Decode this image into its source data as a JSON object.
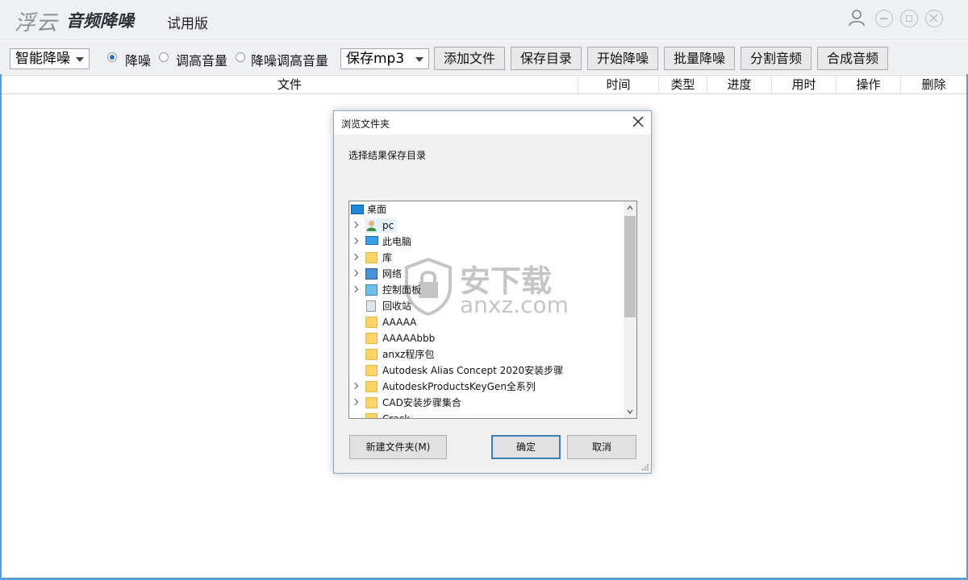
{
  "titlebar": {
    "brand": "浮云",
    "product": "音频降噪",
    "edition": "试用版"
  },
  "toolbar": {
    "mode_select": "智能降噪",
    "radio1": "降噪",
    "radio2": "调高音量",
    "radio3": "降噪调高音量",
    "format_select": "保存mp3",
    "btn_add": "添加文件",
    "btn_savedir": "保存目录",
    "btn_start": "开始降噪",
    "btn_batch": "批量降噪",
    "btn_split": "分割音频",
    "btn_merge": "合成音频"
  },
  "table": {
    "columns": [
      "文件",
      "时间",
      "类型",
      "进度",
      "用时",
      "操作",
      "删除"
    ]
  },
  "dialog": {
    "title": "浏览文件夹",
    "prompt": "选择结果保存目录",
    "tree": [
      {
        "label": "桌面",
        "icon": "desktop-icon"
      },
      {
        "label": "pc",
        "icon": "user-icon"
      },
      {
        "label": "此电脑",
        "icon": "computer-icon"
      },
      {
        "label": "库",
        "icon": "library-icon"
      },
      {
        "label": "网络",
        "icon": "network-icon"
      },
      {
        "label": "控制面板",
        "icon": "control-panel-icon"
      },
      {
        "label": "回收站",
        "icon": "recycle-bin-icon"
      },
      {
        "label": "AAAAA",
        "icon": "folder-icon"
      },
      {
        "label": "AAAAAbbb",
        "icon": "folder-icon"
      },
      {
        "label": "anxz程序包",
        "icon": "folder-icon"
      },
      {
        "label": "Autodesk Alias Concept 2020安装步骤",
        "icon": "folder-icon"
      },
      {
        "label": "AutodeskProductsKeyGen全系列",
        "icon": "folder-icon"
      },
      {
        "label": "CAD安装步骤集合",
        "icon": "folder-icon"
      },
      {
        "label": "Crack",
        "icon": "folder-icon"
      }
    ],
    "btn_newfolder": "新建文件夹(M)",
    "btn_ok": "确定",
    "btn_cancel": "取消"
  },
  "watermark": {
    "text": "安下载",
    "sub": "anxz.com"
  }
}
